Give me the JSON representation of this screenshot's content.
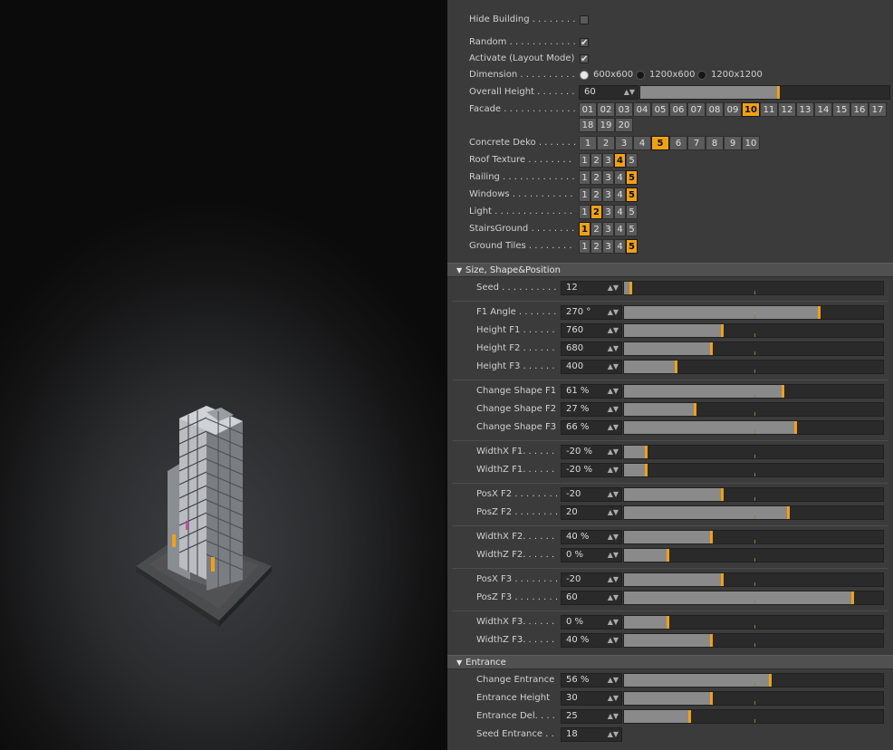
{
  "top": {
    "hide_building": {
      "label": "Hide Building . . . . . . . .",
      "checked": false
    },
    "random": {
      "label": "Random . . . . . . . . . . . . .",
      "checked": true
    },
    "activate": {
      "label": "Activate (Layout Mode)",
      "checked": true
    },
    "dimension": {
      "label": "Dimension . . . . . . . . . .",
      "options": [
        "600x600",
        "1200x600",
        "1200x1200"
      ],
      "selected": "600x600"
    },
    "overall_height": {
      "label": "Overall Height . . . . . . .",
      "value": "60",
      "fraction": 0.55
    },
    "facade": {
      "label": "Facade . . . . . . . . . . . . . .",
      "options": [
        "01",
        "02",
        "03",
        "04",
        "05",
        "06",
        "07",
        "08",
        "09",
        "10",
        "11",
        "12",
        "13",
        "14",
        "15",
        "16",
        "17",
        "18",
        "19",
        "20"
      ],
      "selected": "10"
    },
    "concrete_deko": {
      "label": "Concrete Deko . . . . . . .",
      "options": [
        "1",
        "2",
        "3",
        "4",
        "5",
        "6",
        "7",
        "8",
        "9",
        "10"
      ],
      "selected": "5"
    },
    "roof_texture": {
      "label": "Roof Texture . . . . . . . .",
      "options": [
        "1",
        "2",
        "3",
        "4",
        "5"
      ],
      "selected": "4"
    },
    "railing": {
      "label": "Railing . . . . . . . . . . . . .",
      "options": [
        "1",
        "2",
        "3",
        "4",
        "5"
      ],
      "selected": "5"
    },
    "windows": {
      "label": "Windows . . . . . . . . . . . .",
      "options": [
        "1",
        "2",
        "3",
        "4",
        "5"
      ],
      "selected": "5"
    },
    "light": {
      "label": "Light . . . . . . . . . . . . . . .",
      "options": [
        "1",
        "2",
        "3",
        "4",
        "5"
      ],
      "selected": "2"
    },
    "stairs_ground": {
      "label": "StairsGround . . . . . . . .",
      "options": [
        "1",
        "2",
        "3",
        "4",
        "5"
      ],
      "selected": "1"
    },
    "ground_tiles": {
      "label": "Ground Tiles . . . . . . . .",
      "options": [
        "1",
        "2",
        "3",
        "4",
        "5"
      ],
      "selected": "5"
    }
  },
  "size_section": {
    "title": "Size, Shape&Position",
    "params": [
      {
        "id": "seed",
        "label": "Seed . . . . . . . . . . . .",
        "value": "12",
        "fraction": 0.02
      },
      {
        "id": "f1-angle",
        "label": "F1 Angle . . . . . . .",
        "value": "270 °",
        "fraction": 0.75
      },
      {
        "id": "height-f1",
        "label": "Height F1 . . . . . .",
        "value": "760",
        "fraction": 0.375
      },
      {
        "id": "height-f2",
        "label": "Height F2 . . . . . .",
        "value": "680",
        "fraction": 0.335
      },
      {
        "id": "height-f3",
        "label": "Height F3 . . . . . .",
        "value": "400",
        "fraction": 0.195
      },
      {
        "id": "change-shape-f1",
        "label": "Change Shape F1",
        "value": "61 %",
        "fraction": 0.61
      },
      {
        "id": "change-shape-f2",
        "label": "Change Shape F2",
        "value": "27 %",
        "fraction": 0.27
      },
      {
        "id": "change-shape-f3",
        "label": "Change Shape F3",
        "value": "66 %",
        "fraction": 0.66
      },
      {
        "id": "widthx-f1",
        "label": "WidthX F1. . . . . .",
        "value": "-20 %",
        "fraction": 0.08
      },
      {
        "id": "widthz-f1",
        "label": "WidthZ F1. . . . . .",
        "value": "-20 %",
        "fraction": 0.08
      },
      {
        "id": "posx-f2",
        "label": "PosX F2 . . . . . . . .",
        "value": "-20",
        "fraction": 0.375
      },
      {
        "id": "posz-f2",
        "label": "PosZ F2 . . . . . . . .",
        "value": "20",
        "fraction": 0.63
      },
      {
        "id": "widthx-f2",
        "label": "WidthX F2. . . . . .",
        "value": "40 %",
        "fraction": 0.335
      },
      {
        "id": "widthz-f2",
        "label": "WidthZ F2. . . . . .",
        "value": "0 %",
        "fraction": 0.165
      },
      {
        "id": "posx-f3",
        "label": "PosX F3 . . . . . . . .",
        "value": "-20",
        "fraction": 0.375
      },
      {
        "id": "posz-f3",
        "label": "PosZ F3 . . . . . . . .",
        "value": "60",
        "fraction": 0.88
      },
      {
        "id": "widthx-f3",
        "label": "WidthX F3. . . . . .",
        "value": "0 %",
        "fraction": 0.165
      },
      {
        "id": "widthz-f3",
        "label": "WidthZ F3. . . . . .",
        "value": "40 %",
        "fraction": 0.335
      }
    ]
  },
  "entrance_section": {
    "title": "Entrance",
    "params": [
      {
        "id": "change-entrance",
        "label": "Change Entrance",
        "value": "56 %",
        "fraction": 0.56
      },
      {
        "id": "entrance-height",
        "label": "Entrance Height",
        "value": "30",
        "fraction": 0.335
      },
      {
        "id": "entrance-del",
        "label": "Entrance Del. . . . .",
        "value": "25",
        "fraction": 0.25
      },
      {
        "id": "seed-entrance",
        "label": "Seed Entrance . . .",
        "value": "18"
      }
    ]
  },
  "colors": {
    "accent": "#f0a016",
    "panel": "#3b3b3b",
    "section": "#505050"
  },
  "icons": {
    "spinner": "up-down-arrows-icon",
    "collapse": "triangle-down-icon"
  }
}
